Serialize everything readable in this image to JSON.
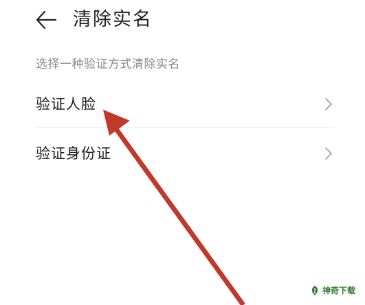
{
  "header": {
    "back_icon": "arrow-left-icon",
    "title": "清除实名"
  },
  "subtitle": "选择一种验证方式清除实名",
  "options": [
    {
      "label": "验证人脸",
      "icon": "chevron-right-icon"
    },
    {
      "label": "验证身份证",
      "icon": "chevron-right-icon"
    }
  ],
  "annotation": {
    "icon": "red-arrow-pointer",
    "color": "#c0392b"
  },
  "watermark": {
    "text": "神奇下载",
    "icon": "leaf-logo-icon",
    "color": "#2f7d32"
  }
}
